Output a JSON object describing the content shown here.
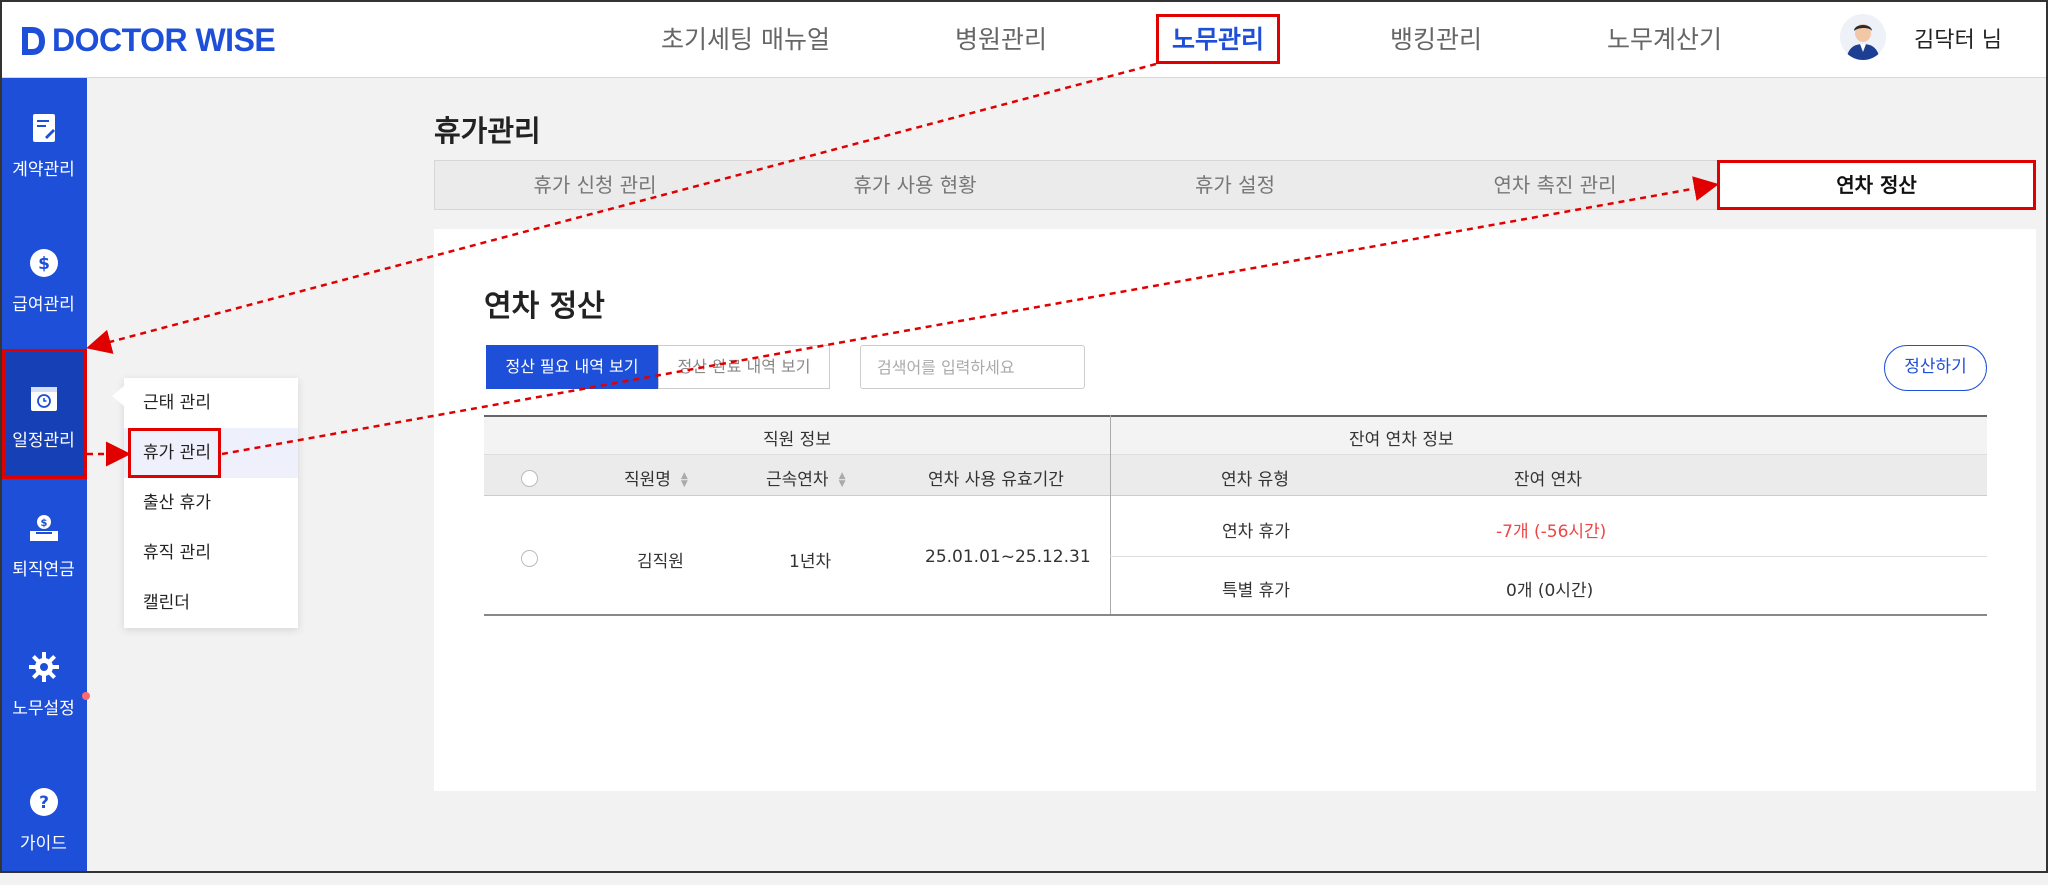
{
  "header": {
    "logo_text": "DOCTOR WISE",
    "nav": [
      {
        "label": "초기세팅 매뉴얼"
      },
      {
        "label": "병원관리"
      },
      {
        "label": "노무관리"
      },
      {
        "label": "뱅킹관리"
      },
      {
        "label": "노무계산기"
      }
    ],
    "active_nav": "노무관리",
    "user_name": "김닥터 님"
  },
  "sidebar": {
    "items": [
      {
        "label": "계약관리",
        "icon": "contract-icon"
      },
      {
        "label": "급여관리",
        "icon": "dollar-icon"
      },
      {
        "label": "일정관리",
        "icon": "calendar-clock-icon"
      },
      {
        "label": "퇴직연금",
        "icon": "pension-icon"
      },
      {
        "label": "노무설정",
        "icon": "gear-icon"
      },
      {
        "label": "가이드",
        "icon": "question-icon"
      }
    ],
    "active": "일정관리"
  },
  "submenu": {
    "items": [
      {
        "label": "근태 관리"
      },
      {
        "label": "휴가 관리"
      },
      {
        "label": "출산 휴가"
      },
      {
        "label": "휴직 관리"
      },
      {
        "label": "캘린더"
      }
    ],
    "active": "휴가 관리"
  },
  "page": {
    "title": "휴가관리",
    "tabs": [
      {
        "label": "휴가 신청 관리"
      },
      {
        "label": "휴가 사용 현황"
      },
      {
        "label": "휴가 설정"
      },
      {
        "label": "연차 촉진 관리"
      },
      {
        "label": "연차 정산"
      }
    ],
    "active_tab": "연차 정산"
  },
  "content": {
    "section_title": "연차 정산",
    "toggle": {
      "on_label": "정산 필요 내역 보기",
      "off_label": "정산 완료 내역 보기"
    },
    "search_placeholder": "검색어를 입력하세요",
    "settle_button": "정산하기",
    "table": {
      "group_headers": [
        "직원 정보",
        "잔여 연차 정보"
      ],
      "columns": [
        "직원명",
        "근속연차",
        "연차 사용 유효기간",
        "연차 유형",
        "잔여 연차"
      ],
      "rows": [
        {
          "name": "김직원",
          "tenure": "1년차",
          "period": "25.01.01~25.12.31",
          "leaves": [
            {
              "type": "연차 휴가",
              "remaining": "-7개 (-56시간)"
            },
            {
              "type": "특별 휴가",
              "remaining": "0개 (0시간)"
            }
          ]
        }
      ]
    }
  },
  "colors": {
    "brand": "#1e4fd8",
    "annotation": "#e00000",
    "negative": "#ee4444"
  }
}
